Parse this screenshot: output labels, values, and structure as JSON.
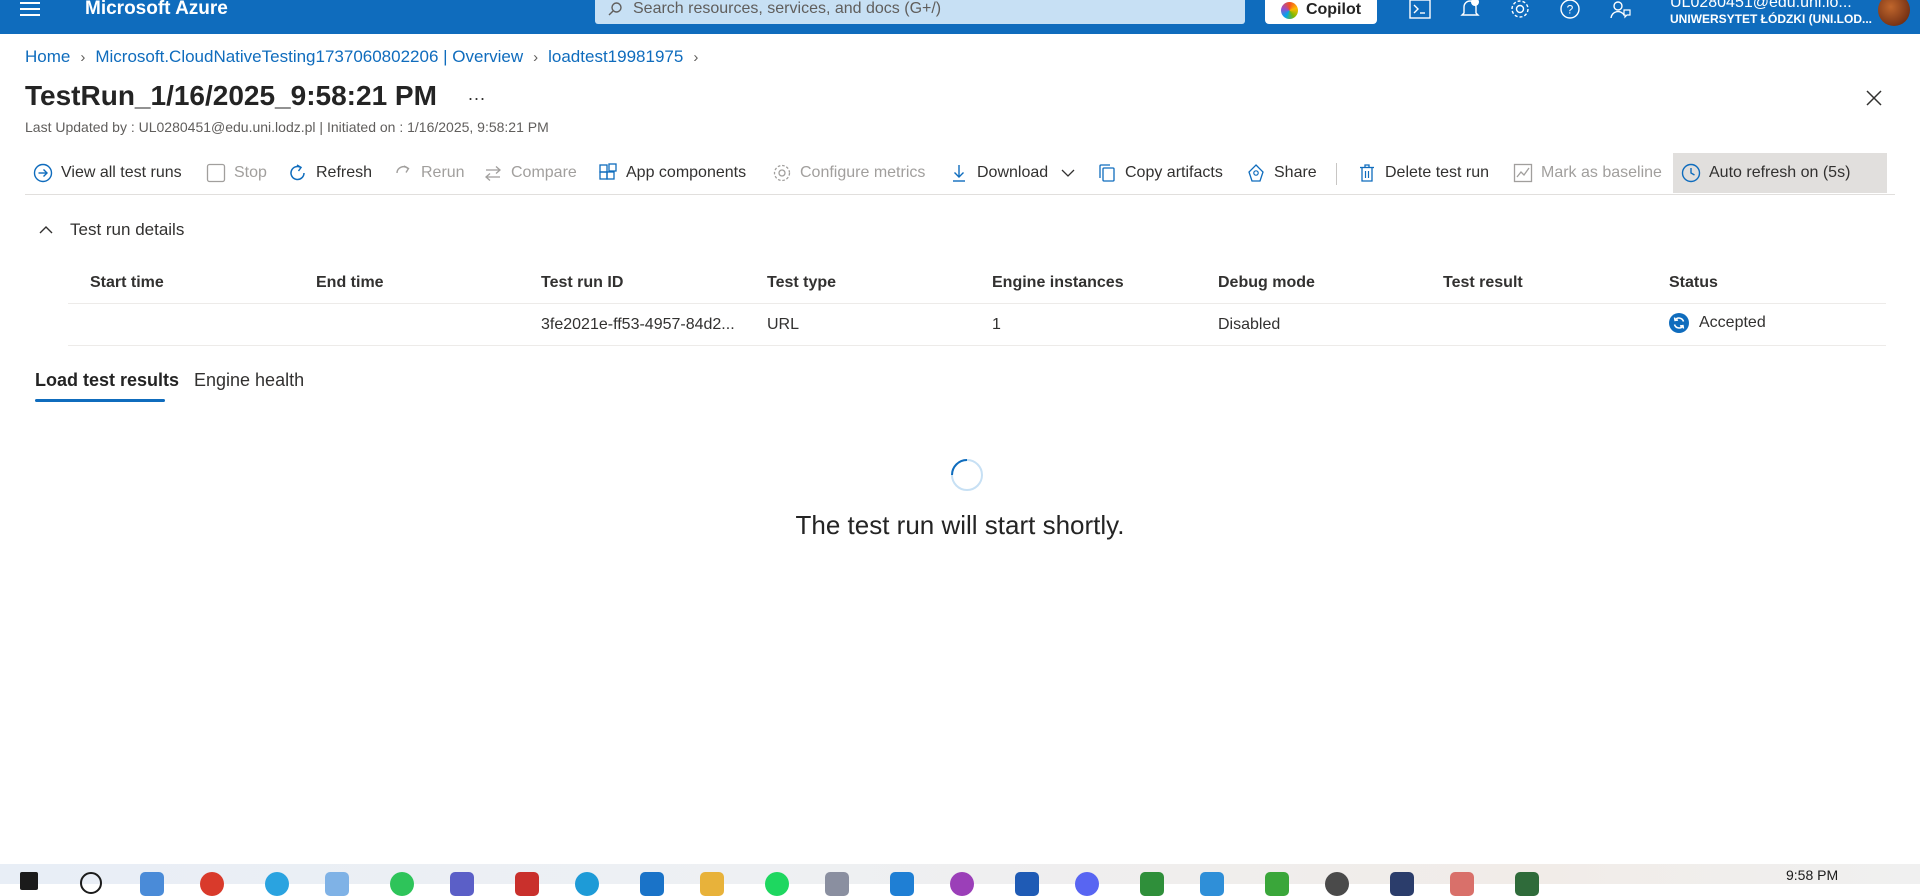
{
  "topbar": {
    "brand": "Microsoft Azure",
    "search_placeholder": "Search resources, services, and docs (G+/)",
    "copilot_label": "Copilot",
    "user_email": "UL0280451@edu.uni.lo...",
    "user_org": "UNIWERSYTET ŁÓDZKI (UNI.LOD...",
    "accent_color": "#0f6cbd"
  },
  "breadcrumb": {
    "items": [
      "Home",
      "Microsoft.CloudNativeTesting1737060802206 | Overview",
      "loadtest19981975"
    ]
  },
  "page": {
    "title": "TestRun_1/16/2025_9:58:21 PM",
    "more": "...",
    "subtitle": "Last Updated by : UL0280451@edu.uni.lodz.pl | Initiated on : 1/16/2025, 9:58:21 PM"
  },
  "toolbar": {
    "view_all": "View all test runs",
    "stop": "Stop",
    "refresh": "Refresh",
    "rerun": "Rerun",
    "compare": "Compare",
    "app_components": "App components",
    "configure_metrics": "Configure metrics",
    "download": "Download",
    "copy_artifacts": "Copy artifacts",
    "share": "Share",
    "delete": "Delete test run",
    "mark_baseline": "Mark as baseline",
    "auto_refresh": "Auto refresh on (5s)"
  },
  "details": {
    "heading": "Test run details",
    "columns": [
      "Start time",
      "End time",
      "Test run ID",
      "Test type",
      "Engine instances",
      "Debug mode",
      "Test result",
      "Status"
    ],
    "row": {
      "start_time": "",
      "end_time": "",
      "test_run_id": "3fe2021e-ff53-4957-84d2...",
      "test_type": "URL",
      "engine_instances": "1",
      "debug_mode": "Disabled",
      "test_result": "",
      "status": "Accepted"
    }
  },
  "tabs": {
    "items": [
      "Load test results",
      "Engine health"
    ],
    "active": "Load test results"
  },
  "main": {
    "loading_text": "The test run will start shortly."
  },
  "taskbar": {
    "time": "9:58 PM"
  }
}
